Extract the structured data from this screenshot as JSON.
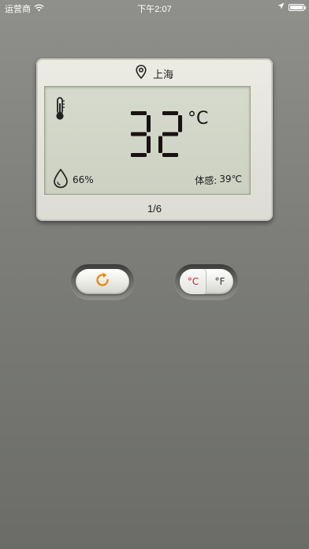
{
  "status_bar": {
    "carrier": "运营商",
    "time": "下午2:07",
    "battery_level": 1.0
  },
  "device": {
    "location": "上海",
    "temperature": "32",
    "temperature_unit": "°C",
    "humidity": "66%",
    "feels_like_label": "体感:",
    "feels_like_value": "39℃",
    "page_indicator": "1/6"
  },
  "controls": {
    "refresh_icon": "refresh-icon",
    "unit_celsius": "°C",
    "unit_fahrenheit": "°F",
    "active_unit": "celsius"
  },
  "colors": {
    "accent_orange": "#f08a12",
    "active_unit_red": "#e21d1d",
    "lcd_background": "#d2d6c7",
    "digit_color": "#1a1212"
  }
}
